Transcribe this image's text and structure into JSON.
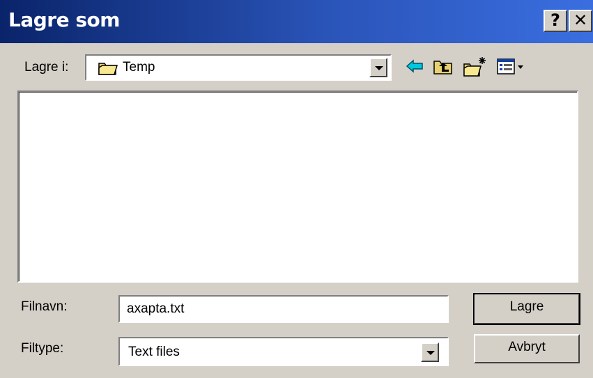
{
  "window": {
    "title": "Lagre som",
    "help_label": "?",
    "close_label": "✕"
  },
  "toolbar": {
    "save_in_label": "Lagre i:",
    "save_in_value": "Temp",
    "icons": [
      "back-icon",
      "up-one-level-icon",
      "new-folder-icon",
      "view-menu-icon"
    ]
  },
  "file_list": {
    "items": []
  },
  "form": {
    "filename_label": "Filnavn:",
    "filename_value": "axapta.txt",
    "filetype_label": "Filtype:",
    "filetype_value": "Text files"
  },
  "buttons": {
    "save_label": "Lagre",
    "cancel_label": "Avbryt"
  },
  "colors": {
    "titlebar_start": "#0a246a",
    "titlebar_end": "#3a6ee0",
    "face": "#d4d0c8",
    "window": "#ffffff"
  }
}
